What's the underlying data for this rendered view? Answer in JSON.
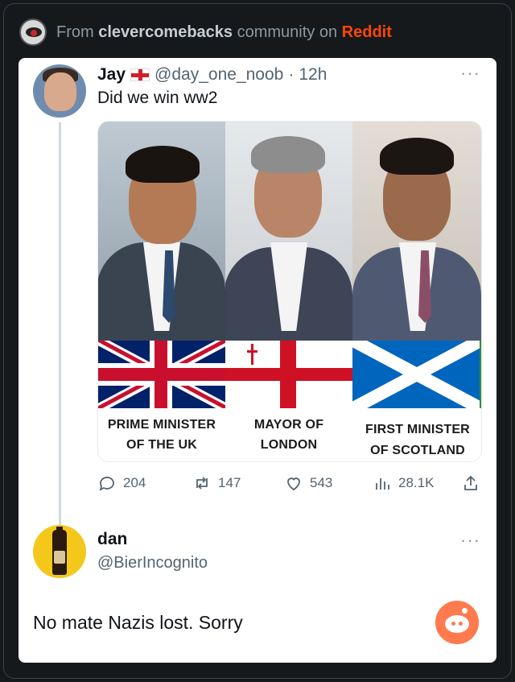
{
  "header": {
    "prefix": "From",
    "community": "clevercomebacks",
    "middle": "community on",
    "platform": "Reddit"
  },
  "tweet": {
    "name": "Jay",
    "flag_icon": "england-flag-icon",
    "handle": "@day_one_noob",
    "separator": "·",
    "time": "12h",
    "more": "···",
    "text": "Did we win ww2",
    "captions": [
      "PRIME MINISTER\nOF THE UK",
      "MAYOR OF\nLONDON",
      "FIRST MINISTER\nOF SCOTLAND"
    ],
    "caption_lines": [
      [
        "PRIME MINISTER",
        "OF THE UK"
      ],
      [
        "MAYOR OF",
        "LONDON"
      ],
      [
        "FIRST MINISTER",
        "OF SCOTLAND"
      ]
    ],
    "stats": {
      "replies": "204",
      "retweets": "147",
      "likes": "543",
      "views": "28.1K"
    }
  },
  "reply": {
    "name": "dan",
    "handle": "@BierIncognito",
    "more": "···",
    "text": "No mate Nazis lost. Sorry"
  },
  "colors": {
    "background": "#15191c",
    "card": "#ffffff",
    "reddit": "#ff4500",
    "reddit_button": "#ff7a4d",
    "muted": "#536471"
  }
}
